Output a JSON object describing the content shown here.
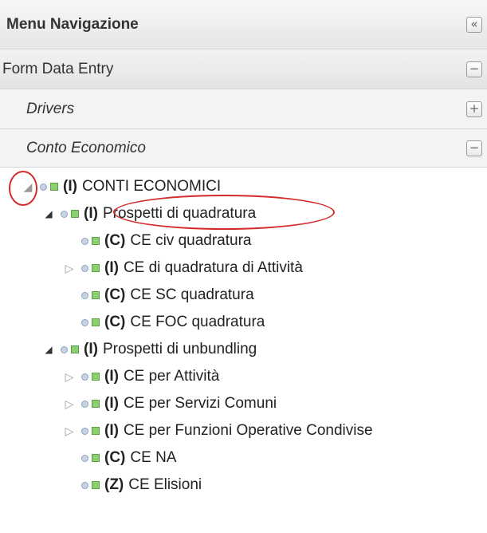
{
  "header": {
    "title": "Menu Navigazione",
    "collapse_icon": "double-chevron-left-icon",
    "collapse_glyph": "«"
  },
  "sections": [
    {
      "label": "Form Data Entry",
      "state_glyph": "−"
    },
    {
      "label": "Drivers",
      "state_glyph": "+"
    },
    {
      "label": "Conto Economico",
      "state_glyph": "−"
    }
  ],
  "tree": [
    {
      "code": "(I)",
      "label": "CONTI ECONOMICI",
      "expander": "◢"
    },
    {
      "code": "(I)",
      "label": "Prospetti di quadratura",
      "expander": "◢"
    },
    {
      "code": "(C)",
      "label": "CE civ quadratura",
      "expander": ""
    },
    {
      "code": "(I)",
      "label": "CE di quadratura di Attività",
      "expander": "▷"
    },
    {
      "code": "(C)",
      "label": "CE SC quadratura",
      "expander": ""
    },
    {
      "code": "(C)",
      "label": "CE FOC quadratura",
      "expander": ""
    },
    {
      "code": "(I)",
      "label": "Prospetti di unbundling",
      "expander": "◢"
    },
    {
      "code": "(I)",
      "label": "CE per Attività",
      "expander": "▷"
    },
    {
      "code": "(I)",
      "label": "CE per Servizi Comuni",
      "expander": "▷"
    },
    {
      "code": "(I)",
      "label": "CE per Funzioni Operative Condivise",
      "expander": "▷"
    },
    {
      "code": "(C)",
      "label": "CE NA",
      "expander": ""
    },
    {
      "code": "(Z)",
      "label": "CE Elisioni",
      "expander": ""
    }
  ],
  "colors": {
    "annotation": "#d42a2a",
    "leaf_square": "#8ccf6e",
    "node_dot": "#c7d3e2"
  }
}
